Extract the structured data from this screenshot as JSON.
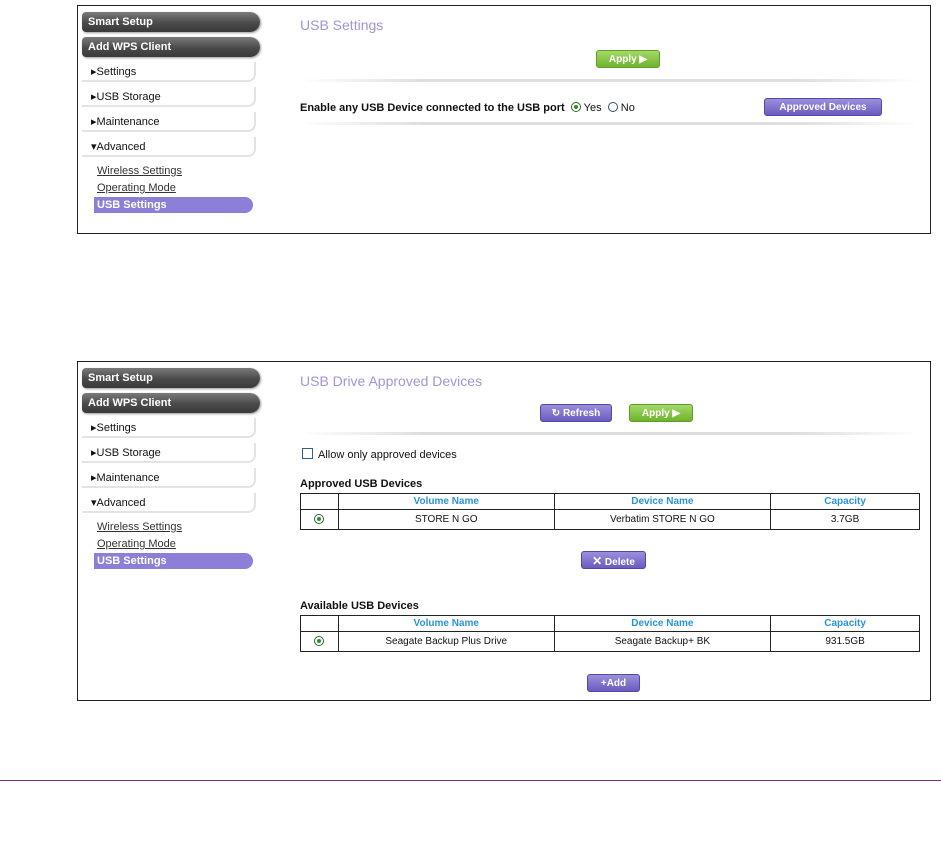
{
  "sidebar": {
    "smart_setup": "Smart Setup",
    "add_wps": "Add WPS Client",
    "items": [
      "▸Settings",
      "▸USB Storage",
      "▸Maintenance",
      "▾Advanced"
    ],
    "sub_links": [
      "Wireless Settings",
      "Operating Mode"
    ],
    "active_link": "USB Settings"
  },
  "usb_settings": {
    "title": "USB Settings",
    "apply_label": "Apply ▶",
    "enable_label": "Enable any USB Device connected to the USB port",
    "yes_label": "Yes",
    "no_label": "No",
    "enabled_selection": "Yes",
    "approved_devices_label": "Approved Devices"
  },
  "approved_page": {
    "title": "USB Drive Approved Devices",
    "refresh_label": "Refresh",
    "apply_label": "Apply ▶",
    "allow_only_label": "Allow only approved devices",
    "allow_only_checked": false,
    "approved_section": "Approved USB Devices",
    "available_section": "Available USB Devices",
    "columns": [
      "Volume Name",
      "Device Name",
      "Capacity"
    ],
    "approved_rows": [
      {
        "volume": "STORE N GO",
        "device": "Verbatim STORE N GO",
        "capacity": "3.7GB"
      }
    ],
    "available_rows": [
      {
        "volume": "Seagate Backup Plus Drive",
        "device": "Seagate Backup+ BK",
        "capacity": "931.5GB"
      }
    ],
    "delete_label": "Delete",
    "add_label": "Add"
  },
  "colors": {
    "title": "#a294d8",
    "accent_purple": "#6a5bbf",
    "accent_green": "#6fb32b",
    "table_header": "#2a93d6",
    "bottom_rule": "#7b2d7b"
  }
}
